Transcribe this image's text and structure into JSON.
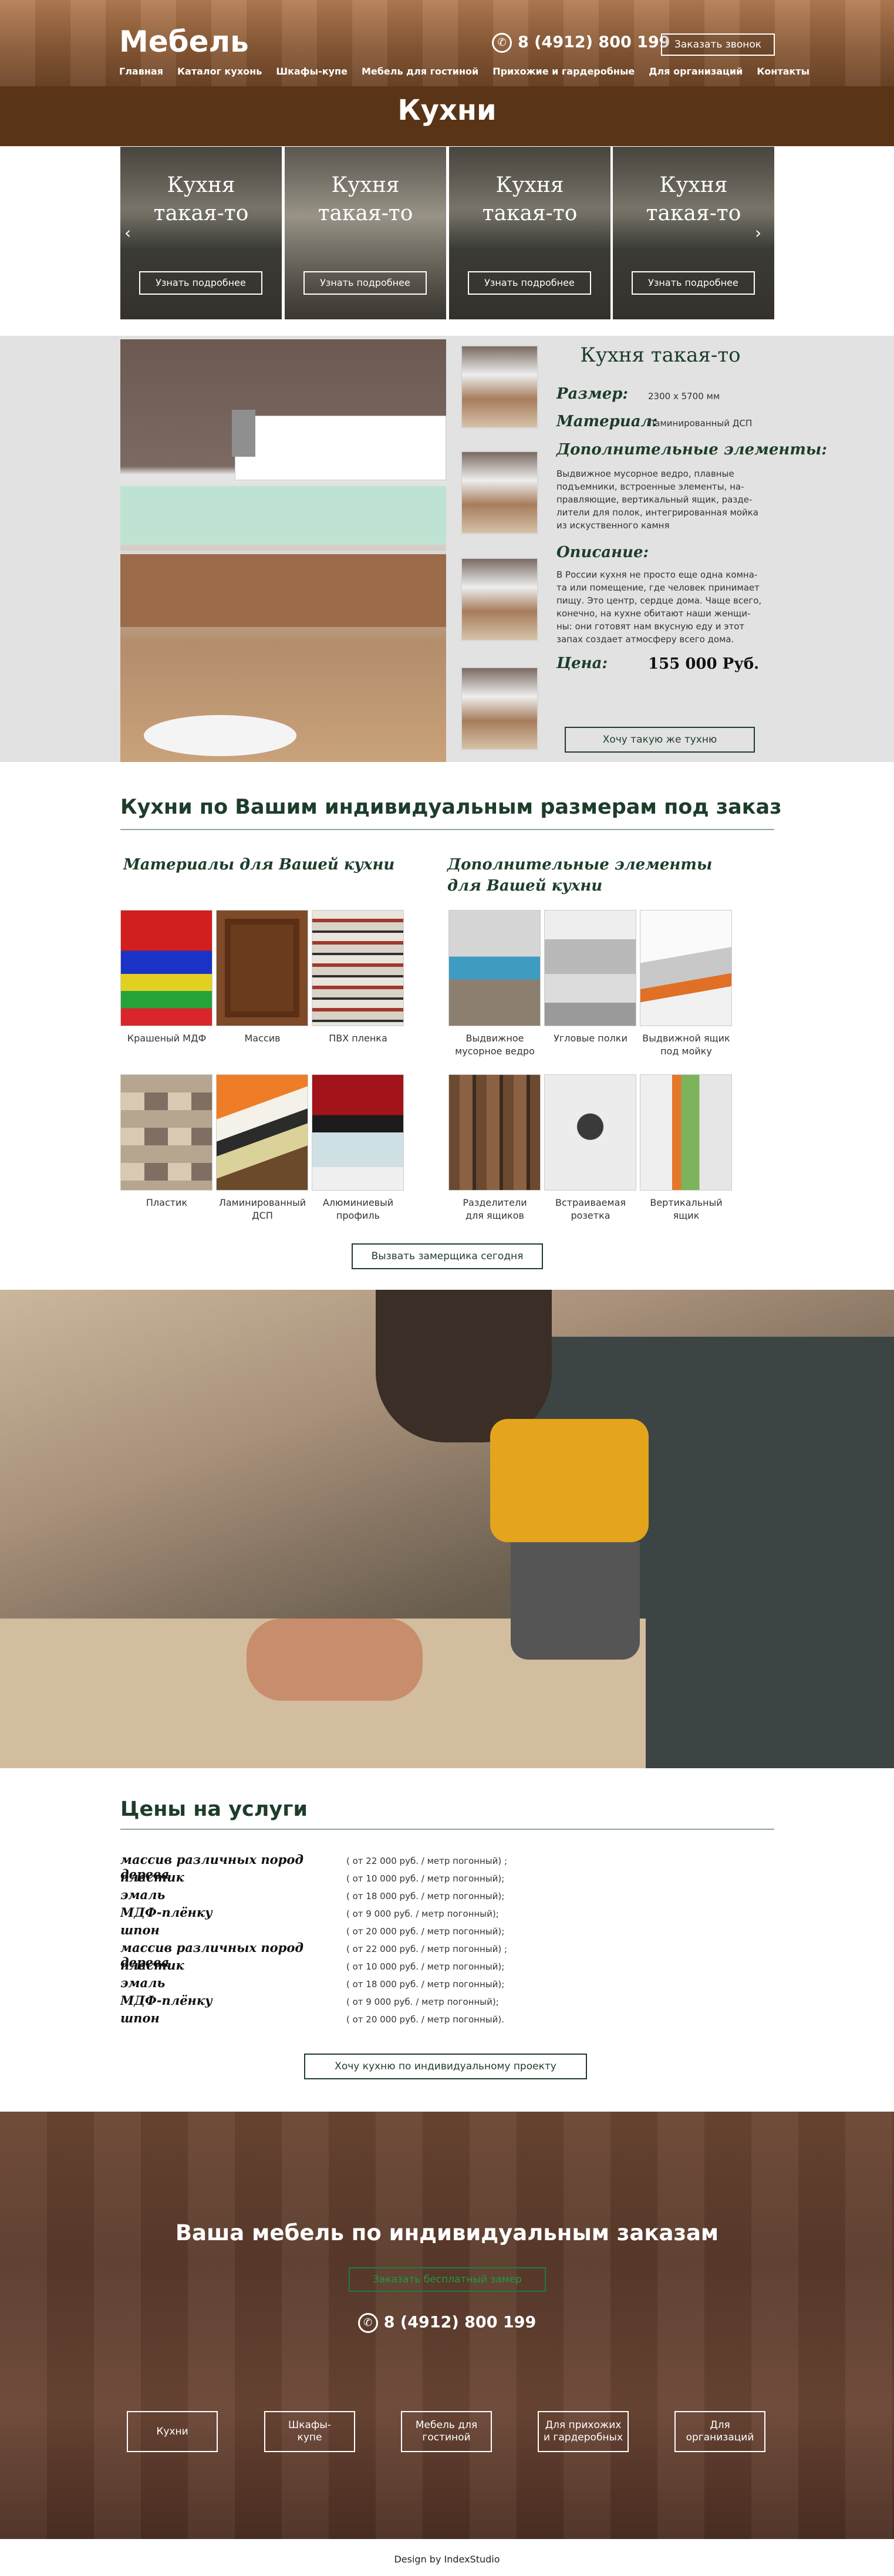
{
  "header": {
    "logo": "Мебель",
    "phone": "8 (4912) 800 199",
    "call_button": "Заказать звонок",
    "nav": [
      "Главная",
      "Каталог кухонь",
      "Шкафы-купе",
      "Мебель для гостиной",
      "Прихожие и гардеробные",
      "Для организаций",
      "Контакты"
    ]
  },
  "page_title": "Кухни",
  "carousel": {
    "items": [
      {
        "title_line1": "Кухня",
        "title_line2": "такая-то",
        "button": "Узнать подробнее"
      },
      {
        "title_line1": "Кухня",
        "title_line2": "такая-то",
        "button": "Узнать подробнее"
      },
      {
        "title_line1": "Кухня",
        "title_line2": "такая-то",
        "button": "Узнать подробнее"
      },
      {
        "title_line1": "Кухня",
        "title_line2": "такая-то",
        "button": "Узнать подробнее"
      }
    ],
    "prev_icon": "chevron-left-icon",
    "next_icon": "chevron-right-icon"
  },
  "detail": {
    "title": "Кухня такая-то",
    "size_label": "Размер:",
    "size_value": "2300 х 5700 мм",
    "material_label": "Материал:",
    "material_value": "Ламинированный ДСП",
    "extras_label": "Дополнительные элементы:",
    "extras_text": "Выдвижное мусорное ведро, плавные подъемники, встроенные элементы, на-правляющие, вертикальный ящик, разде-лители для полок, интегрированная мойка из искуственного камня",
    "desc_label": "Описание:",
    "desc_text": "В России кухня не просто еще одна комна-та или помещение, где человек принимает пищу. Это центр, сердце дома. Чаще всего, конечно, на кухне обитают наши женщи-ны: они готовят нам вкусную еду и этот запах создает атмосферу всего дома.",
    "price_label": "Цена:",
    "price_value": "155 000 Руб.",
    "button": "Хочу такую же тухню"
  },
  "custom": {
    "heading": "Кухни по Вашим индивидуальным размерам под заказ",
    "materials_heading": "Материалы для Вашей кухни",
    "extras_heading_line1": "Дополнительные элементы",
    "extras_heading_line2": "для Вашей кухни",
    "materials": [
      {
        "line1": "Крашеный МДФ",
        "line2": ""
      },
      {
        "line1": "Массив",
        "line2": ""
      },
      {
        "line1": "ПВХ пленка",
        "line2": ""
      },
      {
        "line1": "Пластик",
        "line2": ""
      },
      {
        "line1": "Ламинированный",
        "line2": "ДСП"
      },
      {
        "line1": "Алюминиевый",
        "line2": "профиль"
      }
    ],
    "extras": [
      {
        "line1": "Выдвижное",
        "line2": "мусорное ведро"
      },
      {
        "line1": "Угловые полки",
        "line2": ""
      },
      {
        "line1": "Выдвижной ящик",
        "line2": "под мойку"
      },
      {
        "line1": "Разделители",
        "line2": "для ящиков"
      },
      {
        "line1": "Встраиваемая",
        "line2": "розетка"
      },
      {
        "line1": "Вертикальный",
        "line2": "ящик"
      }
    ],
    "button": "Вызвать замерщика сегодня"
  },
  "prices": {
    "heading": "Цены на услуги",
    "rows": [
      {
        "name": "массив различных пород дерева",
        "value": "( от 22 000 руб. / метр погонный) ;"
      },
      {
        "name": "пластик",
        "value": "( от 10 000 руб. / метр погонный);"
      },
      {
        "name": "эмаль",
        "value": "( от 18 000 руб. / метр погонный);"
      },
      {
        "name": "МДФ-плёнку",
        "value": "( от 9 000 руб. / метр погонный);"
      },
      {
        "name": "шпон",
        "value": "( от 20 000 руб. / метр погонный);"
      },
      {
        "name": "массив различных пород дерева",
        "value": "( от 22 000 руб. / метр погонный) ;"
      },
      {
        "name": "пластик",
        "value": "( от 10 000 руб. / метр погонный);"
      },
      {
        "name": "эмаль",
        "value": "( от 18 000 руб. / метр погонный);"
      },
      {
        "name": "МДФ-плёнку",
        "value": "( от 9 000 руб. / метр погонный);"
      },
      {
        "name": "шпон",
        "value": "( от 20 000 руб. / метр погонный)."
      }
    ],
    "button": "Хочу кухню по индивидуальному проекту"
  },
  "footer_hero": {
    "title": "Ваша мебель по индивидуальным заказам",
    "button": "Заказать бесплатный замер",
    "phone": "8 (4912) 800 199",
    "links": [
      {
        "line1": "Кухни",
        "line2": ""
      },
      {
        "line1": "Шкафы-",
        "line2": "купе"
      },
      {
        "line1": "Мебель для",
        "line2": "гостиной"
      },
      {
        "line1": "Для прихожих",
        "line2": "и гардеробных"
      },
      {
        "line1": "Для",
        "line2": "организаций"
      }
    ]
  },
  "credit": "Design by IndexStudio",
  "colors": {
    "brown": "#5a3417",
    "green": "#1d3d2a",
    "accent": "#1d9a45"
  }
}
